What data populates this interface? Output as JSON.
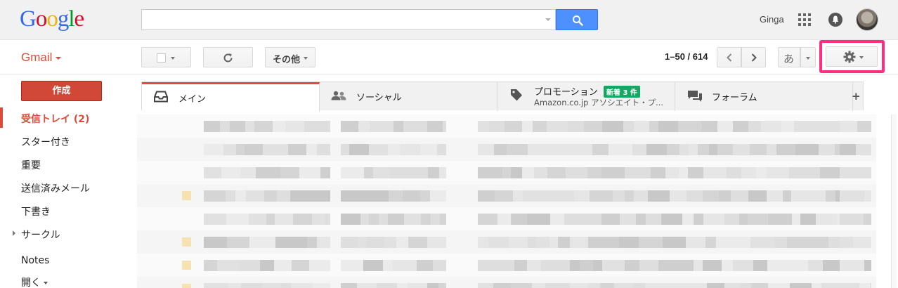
{
  "header": {
    "logo_letters": [
      {
        "ch": "G",
        "color": "#3369e8"
      },
      {
        "ch": "o",
        "color": "#d50f25"
      },
      {
        "ch": "o",
        "color": "#eeb211"
      },
      {
        "ch": "g",
        "color": "#3369e8"
      },
      {
        "ch": "l",
        "color": "#009925"
      },
      {
        "ch": "e",
        "color": "#d50f25"
      }
    ],
    "search": {
      "value": "",
      "placeholder": ""
    },
    "user_name": "Ginga",
    "icons": [
      "search-icon",
      "apps-grid-icon",
      "notifications-bell-icon",
      "account-avatar"
    ]
  },
  "toolbar": {
    "gmail_label": "Gmail",
    "more_label": "その他",
    "pager_text": "1–50 / 614",
    "ime_label": "あ",
    "settings_highlight_color": "#ff2e7e",
    "icons": [
      "checkbox-icon",
      "refresh-icon",
      "chevron-left-icon",
      "chevron-right-icon",
      "gear-icon"
    ]
  },
  "sidebar": {
    "compose_label": "作成",
    "items": [
      {
        "label": "受信トレイ (2)",
        "active": true
      },
      {
        "label": "スター付き",
        "active": false
      },
      {
        "label": "重要",
        "active": false
      },
      {
        "label": "送信済みメール",
        "active": false
      },
      {
        "label": "下書き",
        "active": false
      },
      {
        "label": "サークル",
        "active": false
      },
      {
        "label": "Notes",
        "active": false
      },
      {
        "label": "開く",
        "active": false
      }
    ],
    "accent_color": "#dd4b39"
  },
  "tabs": [
    {
      "label": "メイン",
      "active": true,
      "icon": "inbox-icon"
    },
    {
      "label": "ソーシャル",
      "active": false,
      "icon": "people-icon"
    },
    {
      "label": "プロモーション",
      "active": false,
      "icon": "tag-icon",
      "badge": "新着 3 件",
      "subtitle": "Amazon.co.jp アソシエイト・プ..."
    },
    {
      "label": "フォーラム",
      "active": false,
      "icon": "forum-icon"
    }
  ],
  "tabs_add_label": "+",
  "badge_color": "#16a765"
}
